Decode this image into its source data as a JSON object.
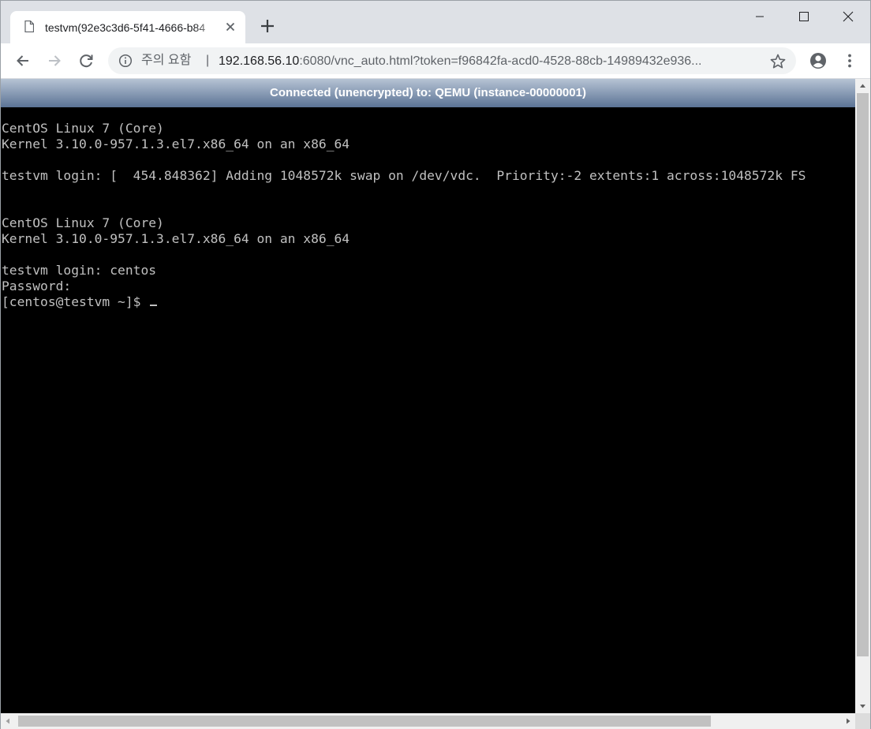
{
  "tab": {
    "title": "testvm(92e3c3d6-5f41-4666-b84",
    "icon": "document-icon",
    "close_icon": "close-icon"
  },
  "toolbar": {
    "security_label": "주의 요함",
    "separator": "|",
    "url_host": "192.168.56.10",
    "url_rest": ":6080/vnc_auto.html?token=f96842fa-acd0-4528-88cb-14989432e936..."
  },
  "vnc": {
    "status": "Connected (unencrypted) to: QEMU (instance-00000001)",
    "status_color": "#5b7395",
    "console_lines": [
      "CentOS Linux 7 (Core)",
      "Kernel 3.10.0-957.1.3.el7.x86_64 on an x86_64",
      "",
      "testvm login: [  454.848362] Adding 1048572k swap on /dev/vdc.  Priority:-2 extents:1 across:1048572k FS",
      "",
      "",
      "CentOS Linux 7 (Core)",
      "Kernel 3.10.0-957.1.3.el7.x86_64 on an x86_64",
      "",
      "testvm login: centos",
      "Password:",
      "[centos@testvm ~]$ "
    ]
  },
  "colors": {
    "tabstrip": "#dee1e6",
    "omnibox": "#f1f3f4",
    "console_bg": "#000000",
    "console_text": "#c0c0c0"
  }
}
